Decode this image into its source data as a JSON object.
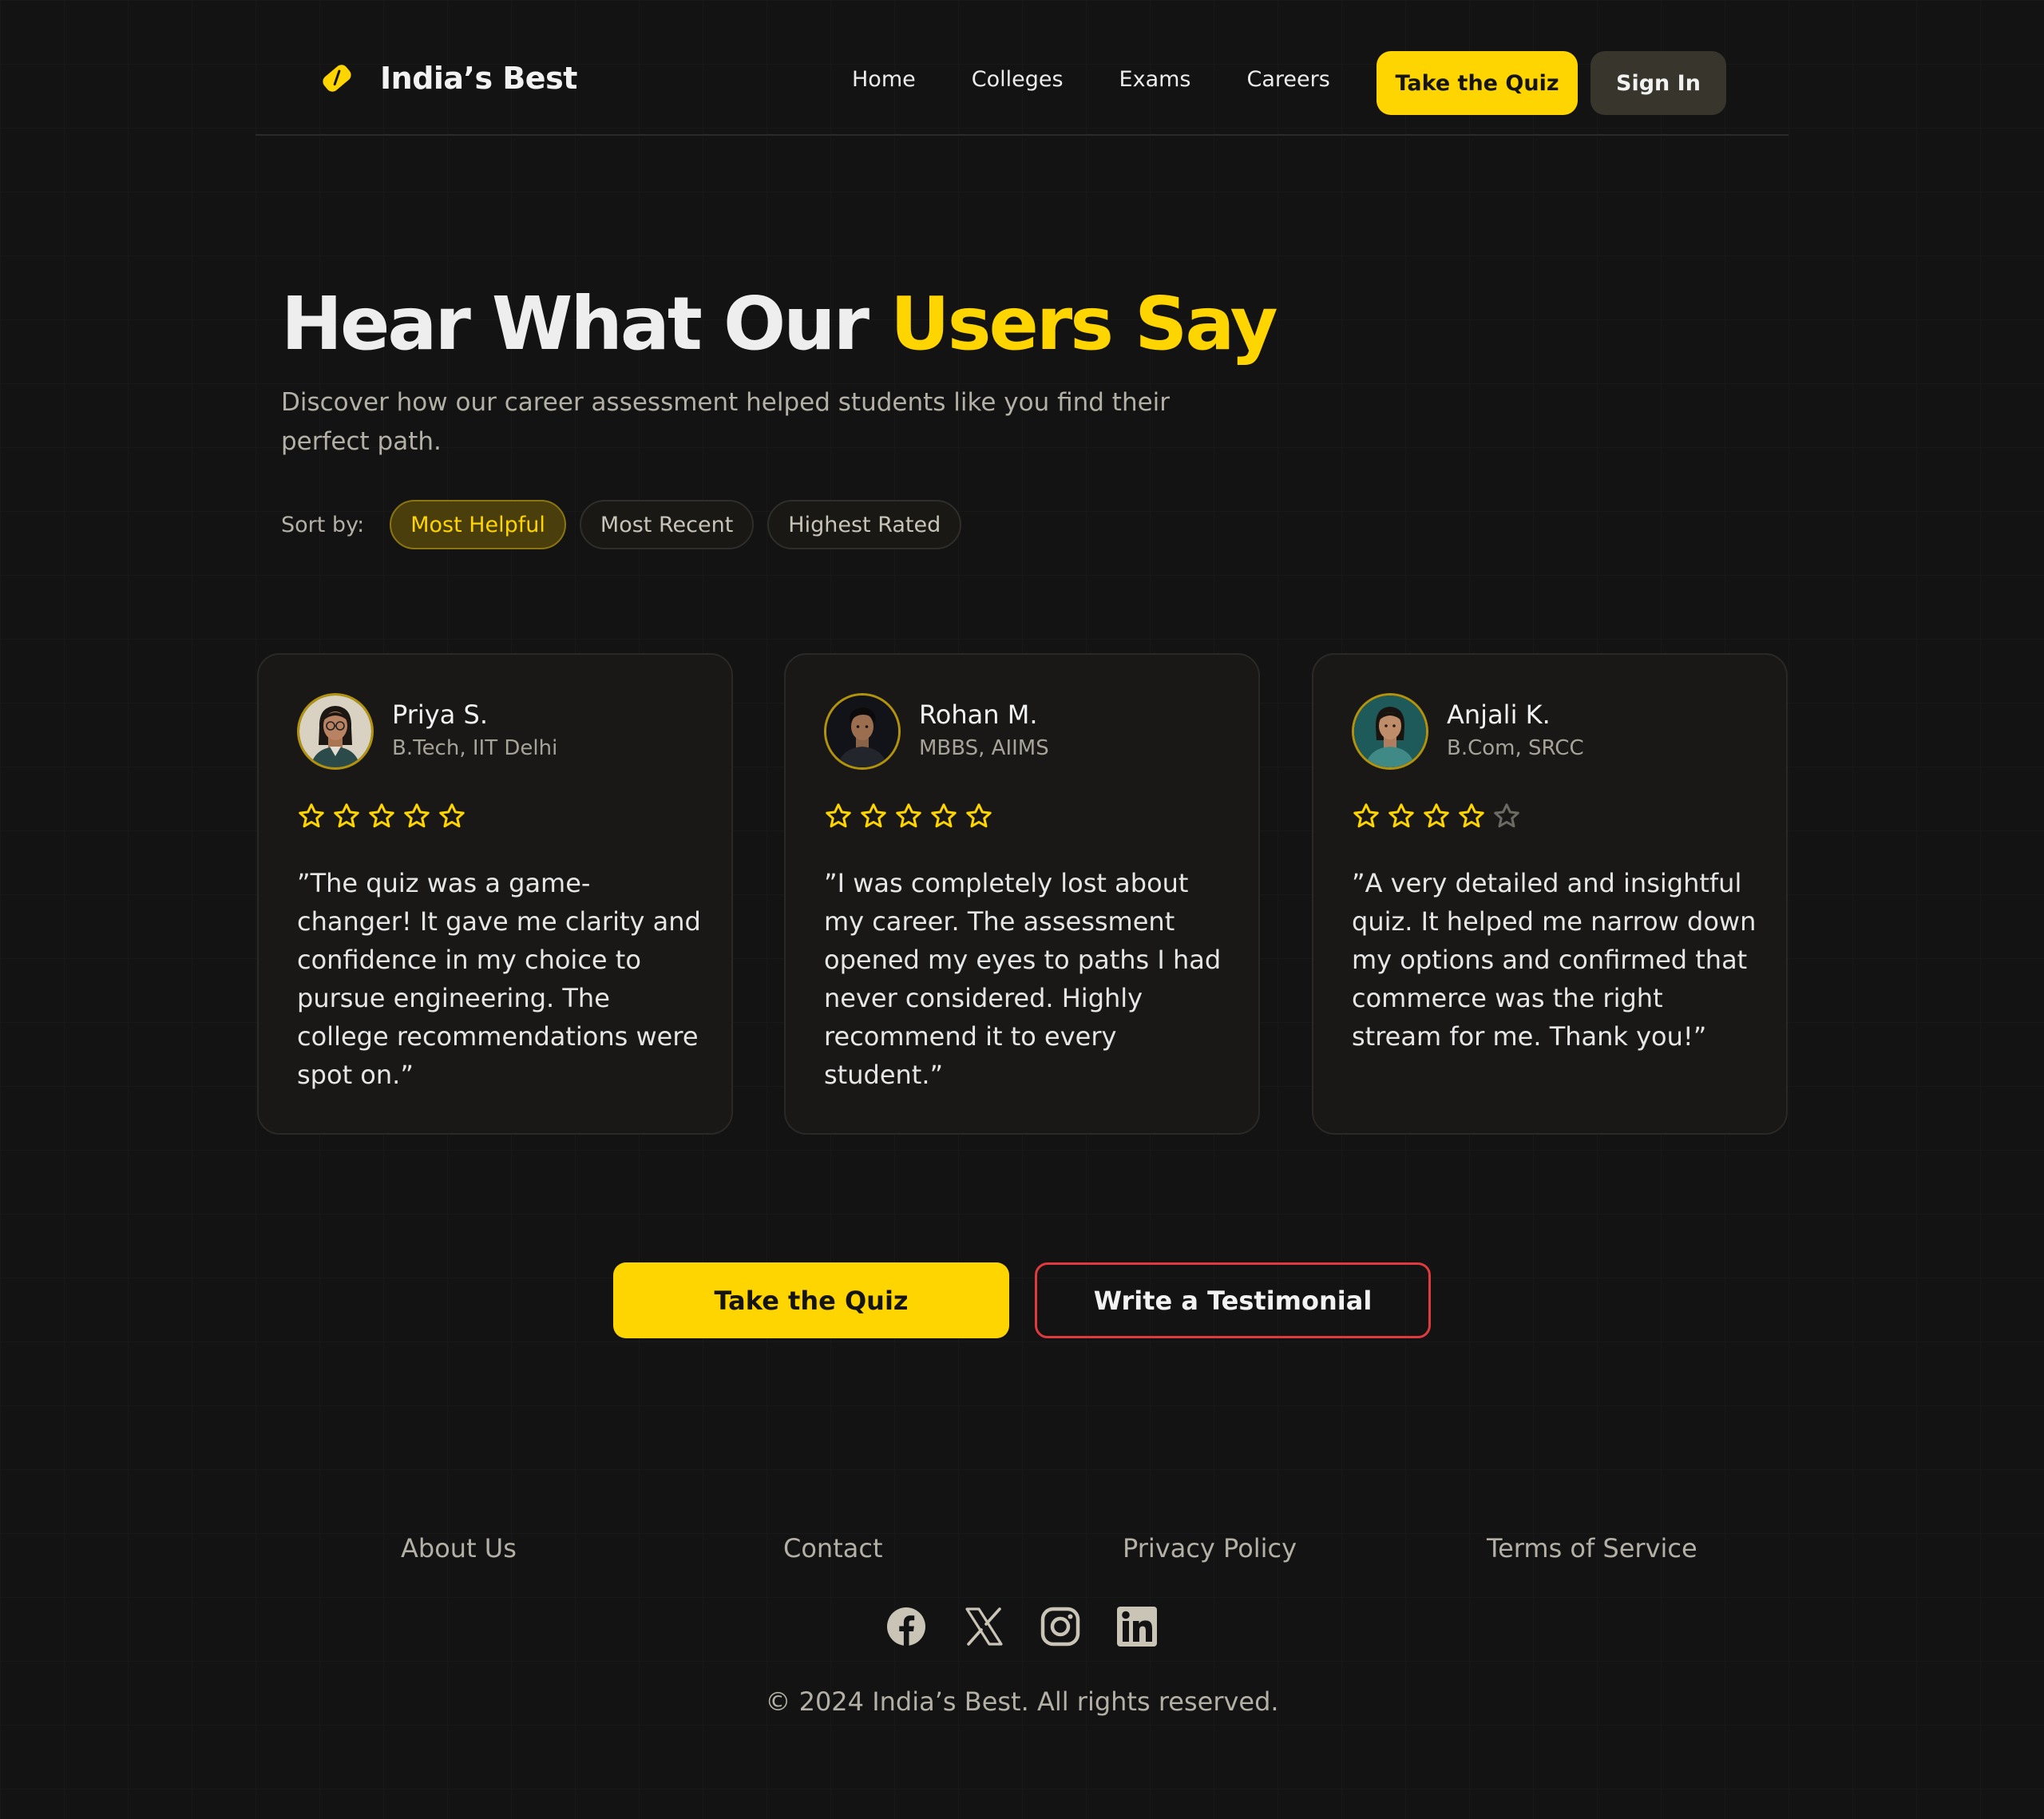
{
  "brand": {
    "name": "India’s Best",
    "accent": "#ffd500"
  },
  "nav": {
    "items": [
      "Home",
      "Colleges",
      "Exams",
      "Careers"
    ],
    "quiz_label": "Take the Quiz",
    "signin_label": "Sign In"
  },
  "hero": {
    "title_plain": "Hear What Our ",
    "title_highlight": "Users Say",
    "subtitle": "Discover how our career assessment helped students like you find their perfect path."
  },
  "sort": {
    "label": "Sort by:",
    "options": [
      "Most Helpful",
      "Most Recent",
      "Highest Rated"
    ],
    "selected": "Most Helpful"
  },
  "testimonials": [
    {
      "name": "Priya S.",
      "role": "B.Tech, IIT Delhi",
      "rating": 5,
      "quote": "”The quiz was a game-changer! It gave me clarity and confidence in my choice to pursue engineering. The college recommendations were spot on.”",
      "avatar_icon": "woman-glasses-avatar"
    },
    {
      "name": "Rohan M.",
      "role": "MBBS, AIIMS",
      "rating": 5,
      "quote": "”I was completely lost about my career. The assessment opened my eyes to paths I had never considered. Highly recommend it to every student.”",
      "avatar_icon": "man-avatar"
    },
    {
      "name": "Anjali K.",
      "role": "B.Com, SRCC",
      "rating": 4,
      "quote": "”A very detailed and insightful quiz. It helped me narrow down my options and confirmed that commerce was the right stream for me. Thank you!”",
      "avatar_icon": "woman-avatar"
    }
  ],
  "cta": {
    "primary": "Take the Quiz",
    "secondary": "Write a Testimonial"
  },
  "footer": {
    "links": [
      "About Us",
      "Contact",
      "Privacy Policy",
      "Terms of Service"
    ],
    "social": [
      "facebook-icon",
      "x-icon",
      "instagram-icon",
      "linkedin-icon"
    ],
    "copyright": "© 2024 India’s Best. All rights reserved."
  }
}
